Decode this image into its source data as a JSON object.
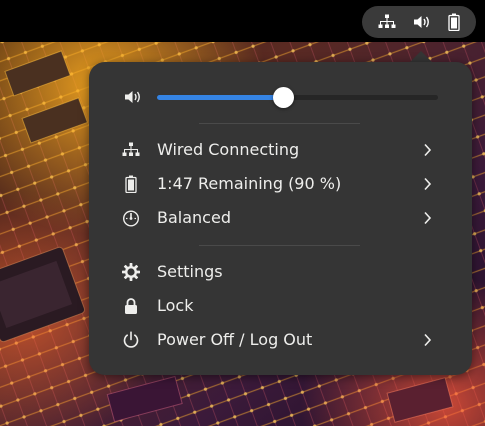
{
  "top_bar": {
    "indicators": [
      {
        "icon": "network-wired-icon"
      },
      {
        "icon": "volume-icon"
      },
      {
        "icon": "battery-icon"
      }
    ]
  },
  "menu": {
    "volume": {
      "icon": "volume-icon",
      "level": 0.45
    },
    "items": [
      {
        "icon": "network-wired-icon",
        "label": "Wired Connecting",
        "has_submenu": true
      },
      {
        "icon": "battery-icon",
        "label": "1:47 Remaining (90 %)",
        "has_submenu": true
      },
      {
        "icon": "power-profile-icon",
        "label": "Balanced",
        "has_submenu": true
      },
      {
        "icon": "gear-icon",
        "label": "Settings",
        "has_submenu": false
      },
      {
        "icon": "lock-icon",
        "label": "Lock",
        "has_submenu": false
      },
      {
        "icon": "power-icon",
        "label": "Power Off / Log Out",
        "has_submenu": true
      }
    ]
  },
  "colors": {
    "top_bar_bg": "#000000",
    "indicator_pill_bg": "#3a3a3a",
    "menu_bg": "#353535",
    "text": "#eeeeec",
    "accent": "#3584e4"
  }
}
